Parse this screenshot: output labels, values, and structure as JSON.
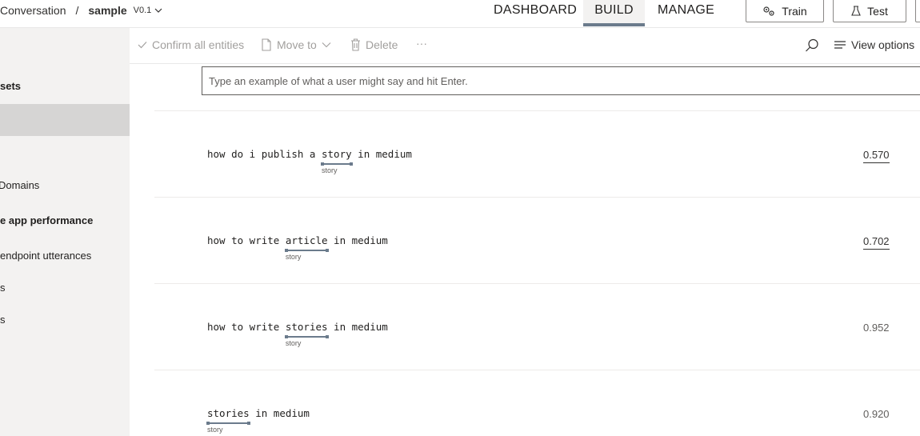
{
  "header": {
    "breadcrumb_root": "Conversation",
    "breadcrumb_sep": "/",
    "app_name": "sample",
    "version": "V0.1",
    "tabs": [
      "DASHBOARD",
      "BUILD",
      "MANAGE"
    ],
    "train_label": "Train",
    "test_label": "Test"
  },
  "sidebar": {
    "items": [
      "sets",
      "",
      "Domains",
      "e app performance",
      "endpoint utterances",
      "s",
      "s"
    ]
  },
  "toolbar": {
    "confirm_label": "Confirm all entities",
    "move_label": "Move to",
    "delete_label": "Delete",
    "more_label": "···",
    "view_options_label": "View options"
  },
  "input": {
    "placeholder": "Type an example of what a user might say and hit Enter."
  },
  "utterances": [
    {
      "before": "how do i publish a ",
      "entity": "story",
      "after": " in medium",
      "entity_label": "story",
      "score": "0.570"
    },
    {
      "before": "how to write ",
      "entity": "article",
      "after": " in medium",
      "entity_label": "story",
      "score": "0.702"
    },
    {
      "before": "how to write ",
      "entity": "stories",
      "after": " in medium",
      "entity_label": "story",
      "score": "0.952"
    },
    {
      "before": "",
      "entity": "stories",
      "after": " in medium",
      "entity_label": "story",
      "score": "0.920"
    }
  ],
  "colors": {
    "accent": "#6b7b8c",
    "sidebar_bg": "#f3f2f1",
    "selected_bg": "#d6d5d4"
  }
}
